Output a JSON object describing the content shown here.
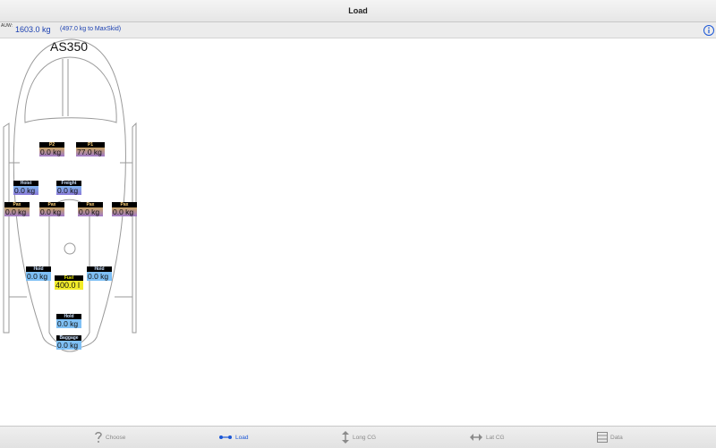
{
  "window": {
    "title": "Load"
  },
  "auw": {
    "label": "AUW:",
    "value": "1603.0 kg",
    "remaining": "(497.0 kg to MaxSkid)"
  },
  "aircraft": {
    "model": "AS350"
  },
  "stations": {
    "p2": {
      "label": "P2",
      "value": "0.0 kg"
    },
    "p1": {
      "label": "P1",
      "value": "77.0 kg"
    },
    "hoist": {
      "label": "Hoist",
      "value": "0.0 kg"
    },
    "freight": {
      "label": "Freight",
      "value": "0.0 kg"
    },
    "pax1": {
      "label": "Pax",
      "value": "0.0 kg"
    },
    "pax2": {
      "label": "Pax",
      "value": "0.0 kg"
    },
    "pax3": {
      "label": "Pax",
      "value": "0.0 kg"
    },
    "pax4": {
      "label": "Pax",
      "value": "0.0 kg"
    },
    "hold_left": {
      "label": "Hold",
      "value": "0.0 kg"
    },
    "fuel": {
      "label": "Fuel",
      "value": "400.0 l"
    },
    "hold_right": {
      "label": "Hold",
      "value": "0.0 kg"
    },
    "hold_rear": {
      "label": "Hold",
      "value": "0.0 kg"
    },
    "baggage": {
      "label": "Baggage",
      "value": "0.0 kg"
    }
  },
  "tabs": [
    {
      "label": "Choose",
      "icon": "question-icon",
      "active": false
    },
    {
      "label": "Load",
      "icon": "load-slider-icon",
      "active": true
    },
    {
      "label": "Long CG",
      "icon": "vertical-arrows-icon",
      "active": false
    },
    {
      "label": "Lat CG",
      "icon": "horizontal-arrows-icon",
      "active": false
    },
    {
      "label": "Data",
      "icon": "table-icon",
      "active": false
    }
  ],
  "colors": {
    "accent": "#1a56d6",
    "auw_text": "#1a3fb0",
    "fuel": "#f2ec2a",
    "hold": "#7fc0f5",
    "crew_pax_gradient": "#c9a464"
  }
}
